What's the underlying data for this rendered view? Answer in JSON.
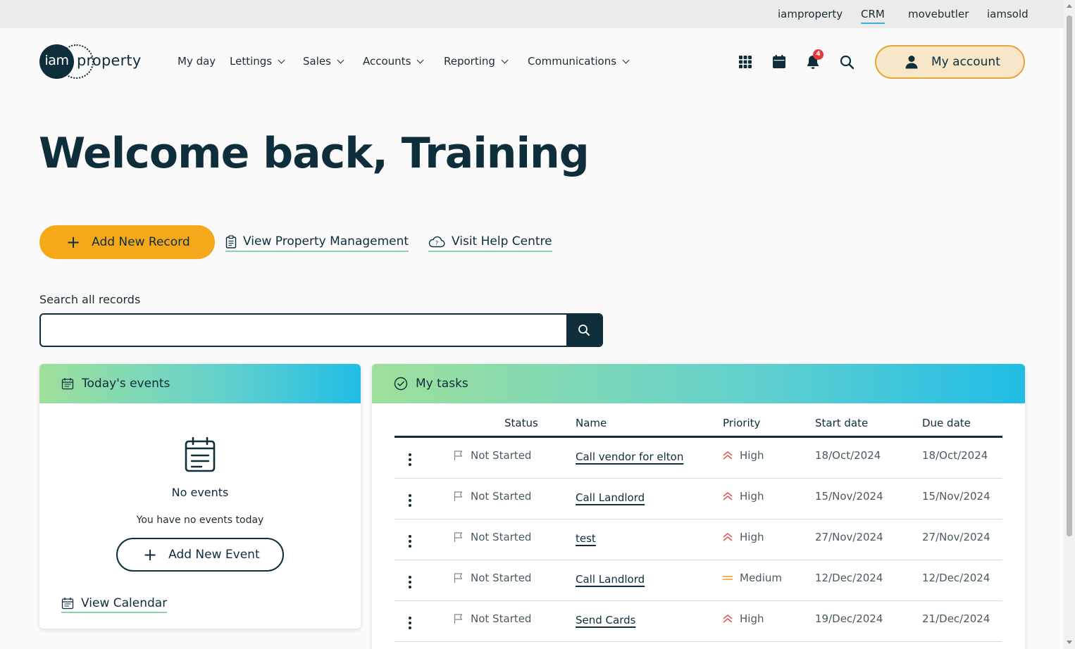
{
  "top_links": [
    {
      "label": "iamproperty",
      "active": false
    },
    {
      "label": "CRM",
      "active": true
    },
    {
      "label": "movebutler",
      "active": false
    },
    {
      "label": "iamsold",
      "active": false
    }
  ],
  "logo": {
    "mark": "iam",
    "text": "property"
  },
  "nav": [
    {
      "label": "My day",
      "dropdown": false
    },
    {
      "label": "Lettings",
      "dropdown": true
    },
    {
      "label": "Sales",
      "dropdown": true
    },
    {
      "label": "Accounts",
      "dropdown": true
    },
    {
      "label": "Reporting",
      "dropdown": true
    },
    {
      "label": "Communications",
      "dropdown": true
    }
  ],
  "header_icons": [
    "apps-grid-icon",
    "calendar-icon",
    "bell-icon",
    "search-icon"
  ],
  "notifications": {
    "count": "4"
  },
  "account": {
    "label": "My account"
  },
  "welcome": "Welcome back, Training",
  "actions": {
    "add_record": "Add New Record",
    "view_property_management": "View Property Management",
    "visit_help_centre": "Visit Help Centre"
  },
  "search": {
    "label": "Search all records",
    "value": "",
    "placeholder": ""
  },
  "events": {
    "title": "Today's events",
    "empty_title": "No events",
    "empty_sub": "You have no events today",
    "add_event": "Add New Event",
    "view_calendar": "View Calendar"
  },
  "tasks": {
    "title": "My tasks",
    "columns": {
      "status": "Status",
      "name": "Name",
      "priority": "Priority",
      "start": "Start date",
      "due": "Due date"
    },
    "rows": [
      {
        "status": "Not Started",
        "name": "Call vendor for elton",
        "priority": "High",
        "start": "18/Oct/2024",
        "due": "18/Oct/2024"
      },
      {
        "status": "Not Started",
        "name": "Call Landlord",
        "priority": "High",
        "start": "15/Nov/2024",
        "due": "15/Nov/2024"
      },
      {
        "status": "Not Started",
        "name": "test",
        "priority": "High",
        "start": "27/Nov/2024",
        "due": "27/Nov/2024"
      },
      {
        "status": "Not Started",
        "name": "Call Landlord",
        "priority": "Medium",
        "start": "12/Dec/2024",
        "due": "12/Dec/2024"
      },
      {
        "status": "Not Started",
        "name": "Send Cards",
        "priority": "High",
        "start": "19/Dec/2024",
        "due": "21/Dec/2024"
      }
    ]
  },
  "colors": {
    "brand_dark": "#0d2e3a",
    "accent_orange": "#f5a81a",
    "high_priority": "#e05555",
    "medium_priority": "#f0a030",
    "link_underline": "#8dd3a4"
  }
}
